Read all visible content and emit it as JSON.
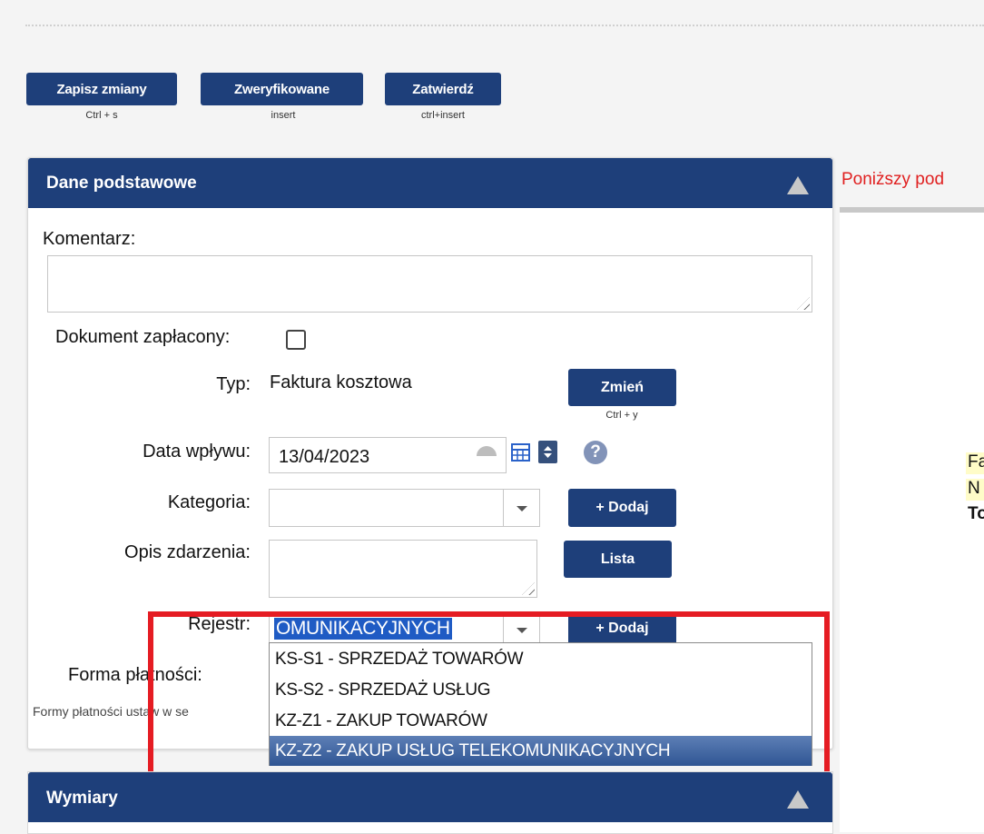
{
  "toolbar": {
    "save": {
      "label": "Zapisz zmiany",
      "shortcut": "Ctrl + s"
    },
    "verified": {
      "label": "Zweryfikowane",
      "shortcut": "insert"
    },
    "approve": {
      "label": "Zatwierdź",
      "shortcut": "ctrl+insert"
    }
  },
  "panel": {
    "title": "Dane podstawowe",
    "comment_label": "Komentarz:",
    "comment_value": "",
    "paid_label": "Dokument zapłacony:",
    "paid_checked": false,
    "type_label": "Typ:",
    "type_value": "Faktura kosztowa",
    "change_button": "Zmień",
    "change_shortcut": "Ctrl + y",
    "date_label": "Data wpływu:",
    "date_value": "13/04/2023",
    "category_label": "Kategoria:",
    "category_value": "",
    "category_add": "+ Dodaj",
    "desc_label": "Opis zdarzenia:",
    "desc_value": "",
    "list_button": "Lista",
    "register_label": "Rejestr:",
    "register_value": "OMUNIKACYJNYCH",
    "register_add": "+ Dodaj",
    "payment_label": "Forma płatności:",
    "payment_hint": "Formy płatności ustaw w se"
  },
  "register_options": [
    {
      "label": "KS-S1 - SPRZEDAŻ TOWARÓW",
      "selected": false
    },
    {
      "label": "KS-S2 - SPRZEDAŻ USŁUG",
      "selected": false
    },
    {
      "label": "KZ-Z1 - ZAKUP TOWARÓW",
      "selected": false
    },
    {
      "label": "KZ-Z2 - ZAKUP USŁUG TELEKOMUNIKACYJNYCH",
      "selected": true
    }
  ],
  "panel2": {
    "title": "Wymiary"
  },
  "right": {
    "notice": "Poniższy pod",
    "line1": "Fa",
    "line2": "N",
    "line3": "To"
  },
  "colors": {
    "accent": "#1e3f7a",
    "highlight": "#e51c23",
    "notice": "#e02020"
  },
  "icons": [
    "collapse-icon",
    "reset-icon",
    "calendar-icon",
    "spinner-icon",
    "help-icon",
    "resize-grip-icon"
  ]
}
